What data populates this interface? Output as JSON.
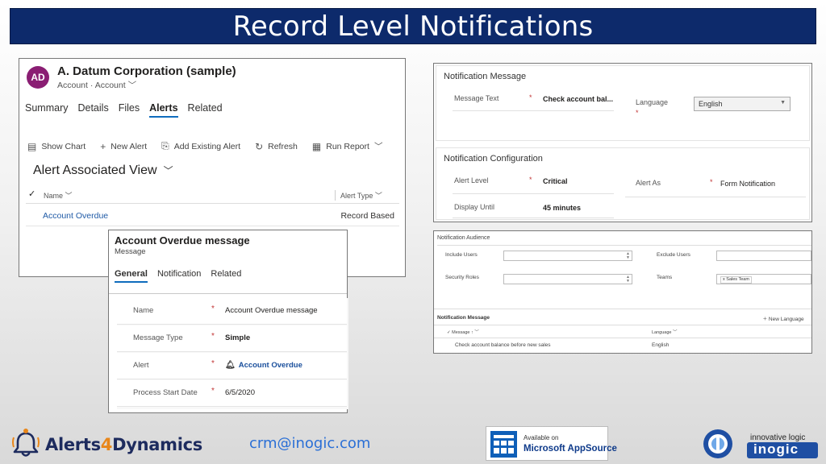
{
  "title": "Record Level Notifications",
  "account_panel": {
    "avatar_initials": "AD",
    "record_title": "A. Datum Corporation (sample)",
    "entity": "Account",
    "form_name": "Account",
    "tabs": [
      {
        "label": "Summary"
      },
      {
        "label": "Details"
      },
      {
        "label": "Files"
      },
      {
        "label": "Alerts",
        "active": true
      },
      {
        "label": "Related"
      }
    ],
    "toolbar": {
      "show_chart": "Show Chart",
      "new_alert": "New Alert",
      "add_existing": "Add Existing Alert",
      "refresh": "Refresh",
      "run_report": "Run Report"
    },
    "view_title": "Alert Associated View",
    "columns": {
      "name": "Name",
      "alert_type": "Alert Type"
    },
    "rows": [
      {
        "name": "Account Overdue",
        "alert_type": "Record Based"
      }
    ]
  },
  "message_panel": {
    "title": "Account Overdue message",
    "entity": "Message",
    "tabs": [
      {
        "label": "General",
        "active": true
      },
      {
        "label": "Notification"
      },
      {
        "label": "Related"
      }
    ],
    "fields": [
      {
        "label": "Name",
        "value": "Account Overdue message"
      },
      {
        "label": "Message Type",
        "value": "Simple"
      },
      {
        "label": "Alert",
        "value": "Account Overdue"
      },
      {
        "label": "Process Start Date",
        "value": "6/5/2020"
      }
    ]
  },
  "config_panel": {
    "message_section": {
      "title": "Notification Message",
      "message_text_label": "Message Text",
      "message_text_value": "Check account bal...",
      "language_label": "Language",
      "language_value": "English"
    },
    "config_section": {
      "title": "Notification Configuration",
      "alert_level_label": "Alert Level",
      "alert_level_value": "Critical",
      "alert_as_label": "Alert As",
      "alert_as_value": "Form Notification",
      "display_until_label": "Display Until",
      "display_until_value": "45 minutes"
    }
  },
  "audience_panel": {
    "title": "Notification Audience",
    "include_users": "Include Users",
    "exclude_users": "Exclude Users",
    "security_roles": "Security Roles",
    "teams": "Teams",
    "teams_chip": "x Sales Team",
    "message_grid_title": "Notification Message",
    "new_language": "New Language",
    "columns": {
      "message": "Message",
      "language": "Language"
    },
    "rows": [
      {
        "message": "Check account balance before new sales",
        "language": "English"
      }
    ]
  },
  "footer": {
    "brand_prefix": "Alerts",
    "brand_number": "4",
    "brand_suffix": "Dynamics",
    "email": "crm@inogic.com",
    "appsource_line1": "Available on",
    "appsource_line2": "Microsoft AppSource",
    "inogic_tagline": "innovative logic",
    "inogic_word": "inogic"
  },
  "colors": {
    "title_bar": "#0d2a6b",
    "accent_tab": "#0f6cbd",
    "link": "#1f5aa6",
    "required": "#c23636",
    "brand_orange": "#e8861a",
    "brand_navy": "#1d2b5e",
    "email": "#2a6fd6"
  }
}
